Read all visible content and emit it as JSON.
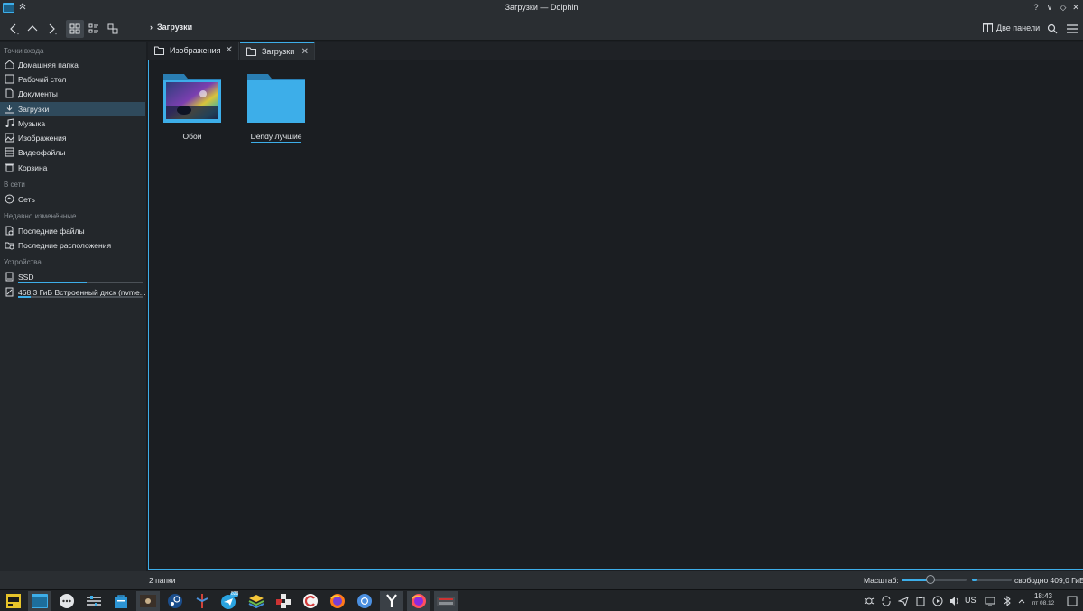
{
  "window": {
    "title": "Загрузки — Dolphin",
    "help_glyph": "?",
    "minimize_glyph": "∨",
    "maximize_glyph": "◇",
    "close_glyph": "✕"
  },
  "toolbar": {
    "breadcrumb_chevron": "›",
    "breadcrumb": "Загрузки",
    "split_label": "Две панели",
    "icons": [
      "back-icon",
      "up-icon",
      "forward-icon",
      "icons-view-icon",
      "details-view-icon",
      "compact-view-icon",
      "split-view-icon",
      "search-icon",
      "hamburger-menu-icon"
    ]
  },
  "sidebar": {
    "sections": [
      {
        "title": "Точки входа",
        "items": [
          {
            "label": "Домашняя папка",
            "icon": "home-icon"
          },
          {
            "label": "Рабочий стол",
            "icon": "desktop-icon"
          },
          {
            "label": "Документы",
            "icon": "documents-icon"
          },
          {
            "label": "Загрузки",
            "icon": "downloads-icon",
            "selected": true
          },
          {
            "label": "Музыка",
            "icon": "music-icon"
          },
          {
            "label": "Изображения",
            "icon": "pictures-icon"
          },
          {
            "label": "Видеофайлы",
            "icon": "videos-icon"
          },
          {
            "label": "Корзина",
            "icon": "trash-icon"
          }
        ]
      },
      {
        "title": "В сети",
        "items": [
          {
            "label": "Сеть",
            "icon": "network-icon"
          }
        ]
      },
      {
        "title": "Недавно изменённые",
        "items": [
          {
            "label": "Последние файлы",
            "icon": "recent-files-icon"
          },
          {
            "label": "Последние расположения",
            "icon": "recent-locations-icon"
          }
        ]
      },
      {
        "title": "Устройства",
        "items": [
          {
            "label": "SSD",
            "icon": "drive-icon",
            "usage": 0.55
          },
          {
            "label": "468,3 ГиБ Встроенный диск (nvme...",
            "icon": "drive-icon",
            "usage": 0.1
          }
        ]
      }
    ]
  },
  "tabs": [
    {
      "label": "Изображения",
      "active": false,
      "close_glyph": "✕"
    },
    {
      "label": "Загрузки",
      "active": true,
      "close_glyph": "✕"
    }
  ],
  "files": [
    {
      "name": "Обои",
      "type": "folder-with-preview",
      "focused": false
    },
    {
      "name": "Dendy лучшие",
      "type": "folder",
      "focused": true
    }
  ],
  "status": {
    "count": "2 папки",
    "zoom_label": "Масштаб:",
    "zoom_level": 0.45,
    "free_space": "свободно 409,0 ГиБ",
    "disk_used_fraction": 0.12
  },
  "taskbar": {
    "apps": [
      "app-launcher",
      "dolphin",
      "dots-menu",
      "settings-app",
      "store",
      "media-player",
      "steam",
      "git-client",
      "telegram",
      "stack-app",
      "games-app",
      "circle-app",
      "firefox",
      "chromium",
      "yandex-browser",
      "firefox-dev",
      "keyboard-app"
    ],
    "telegram_badge": "828",
    "keyboard_layout": "US",
    "time": "18:43",
    "date": "пт 08.12"
  },
  "colors": {
    "accent": "#3daee9",
    "folder": "#3daee9",
    "background": "#1b1e22",
    "panel": "#2a2e32"
  }
}
